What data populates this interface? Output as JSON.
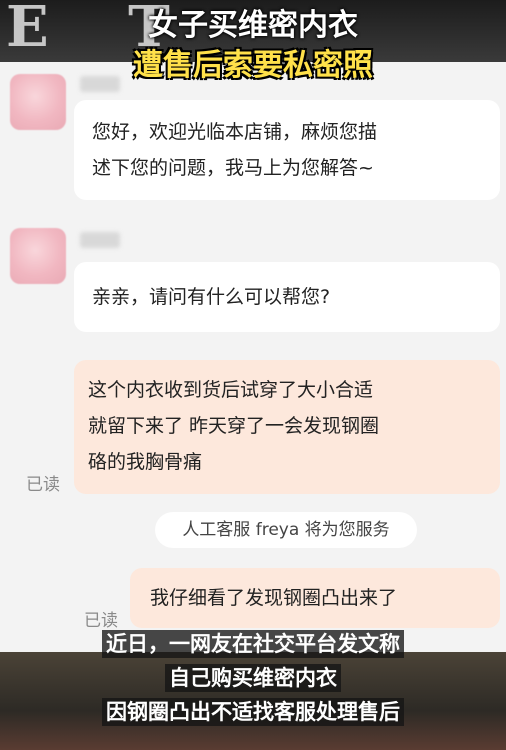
{
  "header": {
    "bg_letters": "E T",
    "title_line1": "女子买维密内衣",
    "title_line2": "遭售后索要私密照"
  },
  "chat": {
    "messages": [
      {
        "side": "in",
        "line1": "您好，欢迎光临本店铺，麻烦您描",
        "line2": "述下您的问题，我马上为您解答~"
      },
      {
        "side": "in",
        "text": "亲亲，请问有什么可以帮您?"
      },
      {
        "side": "out",
        "line1": "这个内衣收到货后试穿了大小合适",
        "line2": "就留下来了 昨天穿了一会发现钢圈",
        "line3": "硌的我胸骨痛",
        "status": "已读"
      },
      {
        "side": "out",
        "text": "我仔细看了发现钢圈凸出来了",
        "status": "已读"
      }
    ],
    "system_note": "人工客服 freya 将为您服务"
  },
  "caption": {
    "line1": "近日，一网友在社交平台发文称",
    "line2": "自己购买维密内衣",
    "line3": "因钢圈凸出不适找客服处理售后"
  },
  "colors": {
    "title_yellow": "#ffe14a",
    "incoming_bubble": "#ffffff",
    "outgoing_bubble": "#fde8dc",
    "background": "#f3f3f3"
  }
}
